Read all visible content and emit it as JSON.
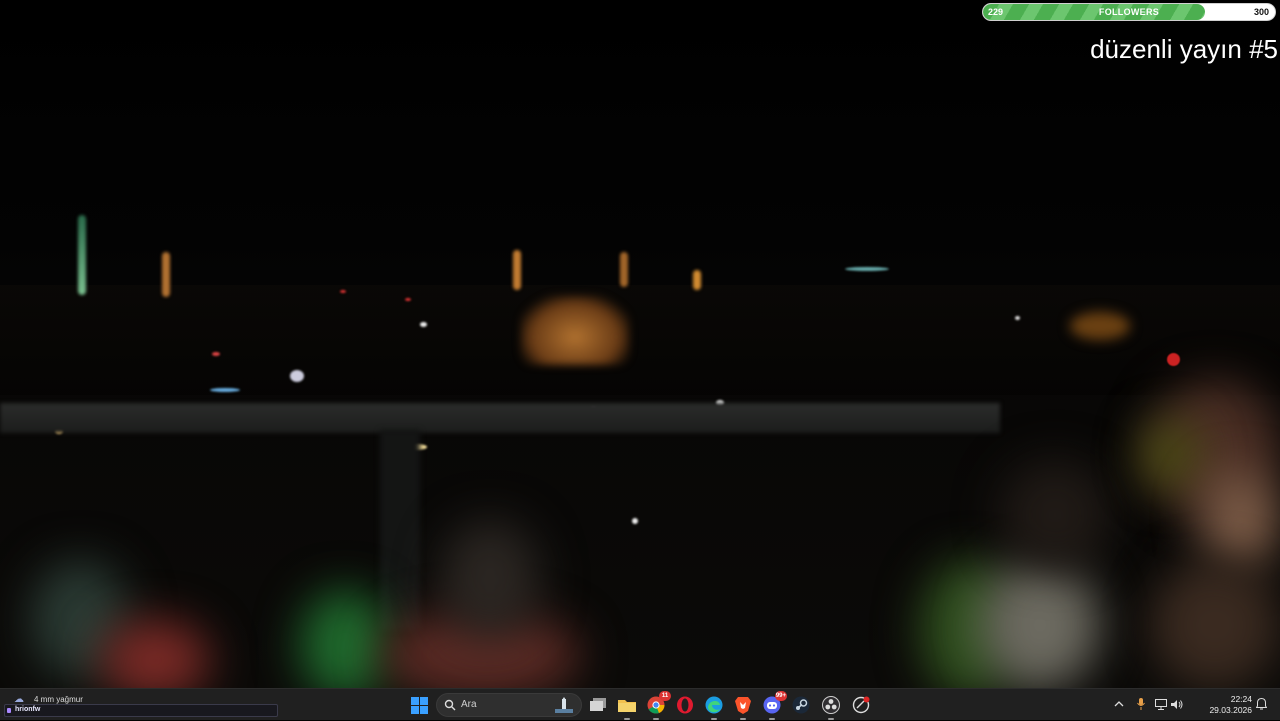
{
  "overlay": {
    "followers": {
      "label": "FOLLOWERS",
      "current": "229",
      "goal": "300",
      "progress_fraction": 0.76
    },
    "stream_title": "düzenli yayın #5"
  },
  "taskbar": {
    "weather": {
      "text": "4 mm yağmur",
      "icon": "rain-cloud-icon"
    },
    "ticker": {
      "text": "hrionfw"
    },
    "search": {
      "placeholder": "Ara"
    },
    "apps": [
      {
        "name": "windows-start-icon"
      },
      {
        "name": "task-view-icon"
      },
      {
        "name": "file-explorer-icon"
      },
      {
        "name": "chrome-icon",
        "badge": "11"
      },
      {
        "name": "opera-icon"
      },
      {
        "name": "edge-icon"
      },
      {
        "name": "brave-icon"
      },
      {
        "name": "discord-icon",
        "badge": "99+"
      },
      {
        "name": "steam-icon"
      },
      {
        "name": "obs-icon"
      },
      {
        "name": "recording-app-icon"
      }
    ],
    "tray": {
      "chevron": "chevron-up-icon",
      "mic": "microphone-icon",
      "network": "network-icon",
      "volume": "speaker-icon",
      "notifications": "notification-icon"
    },
    "clock": {
      "time": "22:24",
      "date": "29.03.2026"
    }
  }
}
